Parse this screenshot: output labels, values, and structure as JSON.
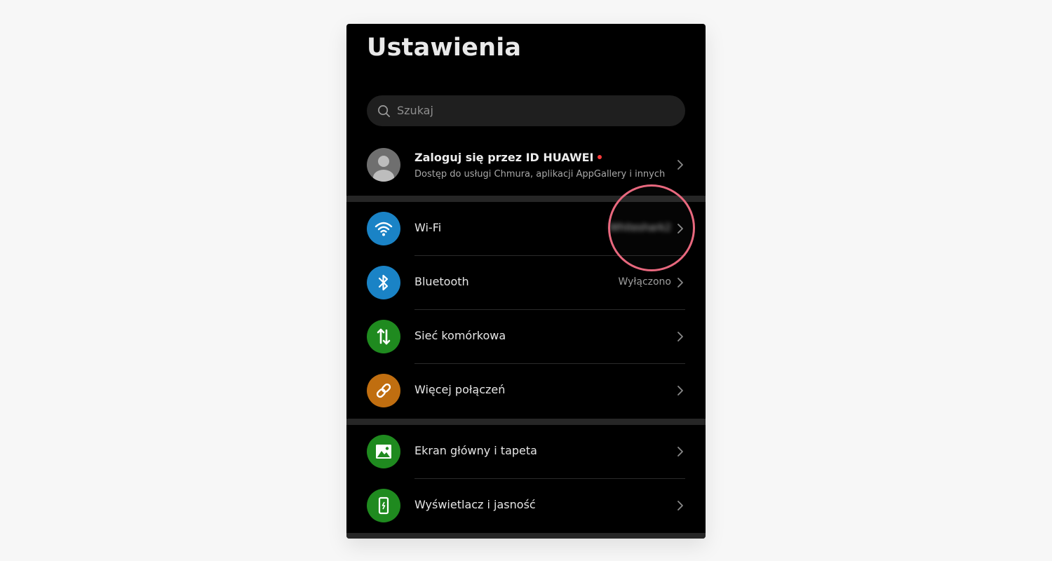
{
  "header": {
    "title": "Ustawienia"
  },
  "search": {
    "placeholder": "Szukaj"
  },
  "account": {
    "name": "Zaloguj się przez ID HUAWEI",
    "description": "Dostęp do usługi Chmura, aplikacji AppGallery i innych"
  },
  "rows": [
    {
      "label": "Wi-Fi",
      "value": "Whiteshark2",
      "icon": "wifi-icon",
      "color": "#1a83c6"
    },
    {
      "label": "Bluetooth",
      "value": "Wyłączono",
      "icon": "bluetooth-icon",
      "color": "#1a83c6"
    },
    {
      "label": "Sieć komórkowa",
      "value": "",
      "icon": "mobile-data-icon",
      "color": "#1f8a1f"
    },
    {
      "label": "Więcej połączeń",
      "value": "",
      "icon": "link-icon",
      "color": "#c06e10"
    },
    {
      "label": "Ekran główny i tapeta",
      "value": "",
      "icon": "image-icon",
      "color": "#1f8a1f"
    },
    {
      "label": "Wyświetlacz i jasność",
      "value": "",
      "icon": "phone-brightness-icon",
      "color": "#1f8a1f"
    }
  ],
  "colors": {
    "highlight": "#e8687e",
    "notification_dot": "#ff3b3b"
  }
}
